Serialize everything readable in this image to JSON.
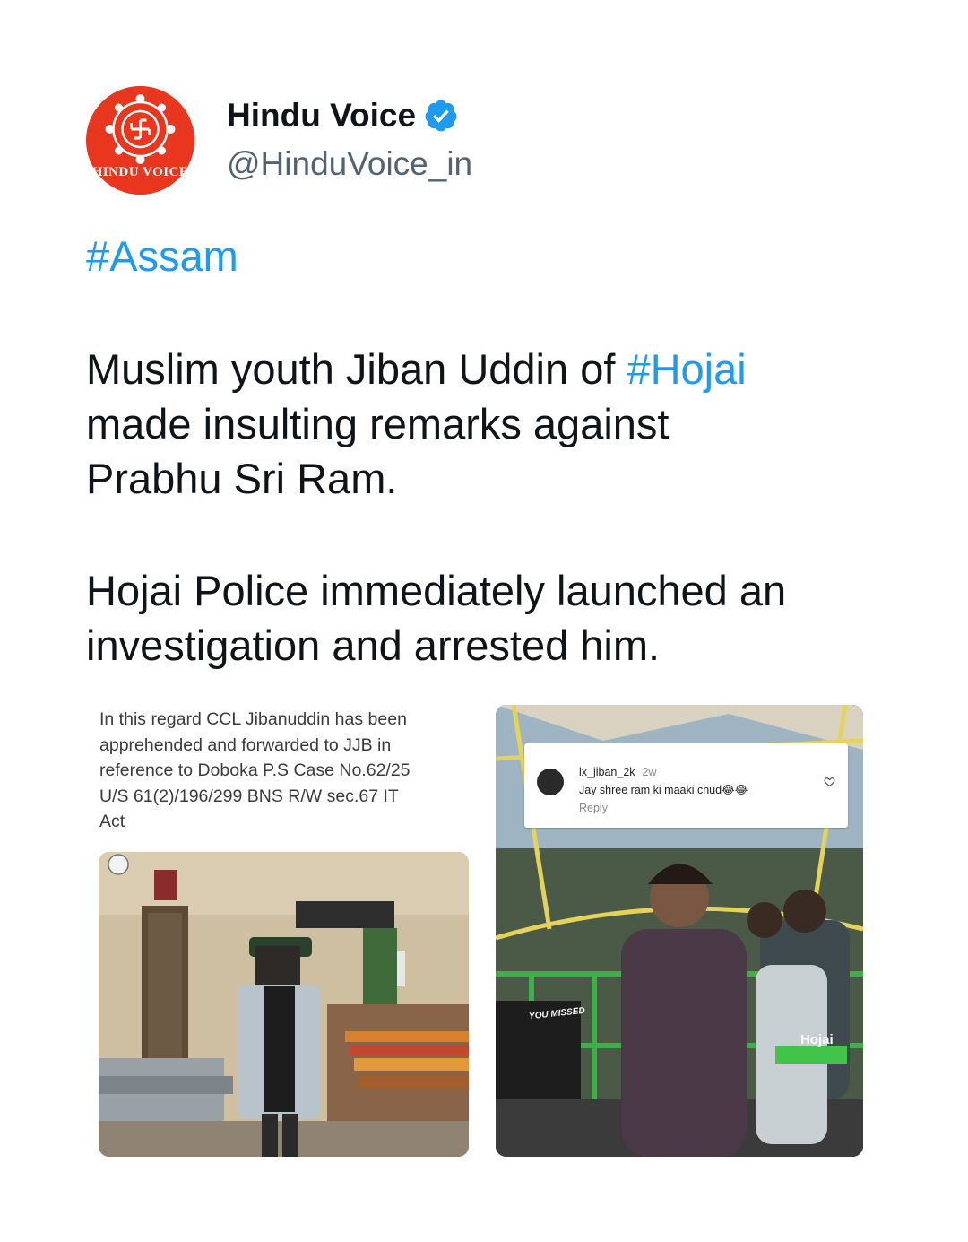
{
  "author": {
    "display_name": "Hindu Voice",
    "handle": "@HinduVoice_in",
    "avatar_text": "HINDU VOICE",
    "verified_color": "#1d9bf0",
    "avatar_color": "#e8361f"
  },
  "tweet": {
    "line1_hashtag": "#Assam",
    "para1_before": "Muslim youth Jiban Uddin of ",
    "para1_hashtag": "#Hojai",
    "para1_after": "made insulting remarks against",
    "para1_end": "Prabhu Sri Ram.",
    "para2_line1": "Hojai Police immediately launched an",
    "para2_line2": "investigation and arrested him.",
    "hashtag_color": "#1d9bf0"
  },
  "media": {
    "caption_lines": [
      "In this regard CCL Jibanuddin has been",
      "apprehended and forwarded to JJB in",
      "reference to Doboka P.S Case No.62/25",
      "U/S 61(2)/196/299 BNS R/W sec.67 IT",
      "Act"
    ],
    "comment": {
      "username": "lx_jiban_2k",
      "time": "2w",
      "text": "Jay shree ram ki maaki chud😂😂",
      "reply_label": "Reply"
    },
    "place_label": "Hojai",
    "sign_text": "YOU MISSED"
  }
}
